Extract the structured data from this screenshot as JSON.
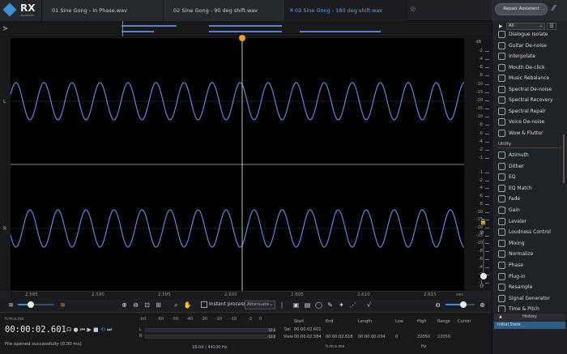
{
  "app": {
    "logo_text": "RX",
    "logo_sub": "ADVANCED"
  },
  "tabs": [
    {
      "label": "01 Sine Gong - In Phase.wav",
      "active": false
    },
    {
      "label": "02 Sine Gong - 90 deg shift.wav",
      "active": false
    },
    {
      "label": "03 Sine Gong - 180 deg shift.wav",
      "active": true
    }
  ],
  "repair_assistant": "Repair Assistant",
  "channels": {
    "left": "L",
    "right": "R"
  },
  "scale_labels": {
    "db": "dB",
    "top": [
      "-2",
      "-4",
      "-6",
      "-8",
      "-10",
      "-15",
      "-20",
      "-15",
      "-10",
      "-8",
      "-6",
      "-4",
      "-2",
      "-1"
    ],
    "bottom": [
      "-1",
      "-2",
      "-4",
      "-6",
      "-8",
      "-10",
      "-15",
      "-20",
      "-15",
      "-10",
      "-8",
      "-6",
      "-4",
      "-2",
      "-1"
    ]
  },
  "timeline": {
    "labels": [
      "2.585",
      "2.590",
      "2.595",
      "2.600",
      "2.605",
      "2.610",
      "2.615"
    ],
    "unit": "sec"
  },
  "toolbar": {
    "instant_process": "Instant process",
    "attenuate": "Attenuate"
  },
  "transport": {
    "format": "h:m:s.ms",
    "time": "00:00:02.601",
    "status": "File opened successfully (0.00 ms)"
  },
  "meter": {
    "scale": [
      "-Inf.",
      "-60",
      "-50",
      "-40",
      "-30",
      "-20",
      "-10",
      "-3",
      "0"
    ],
    "l_label": "L",
    "r_label": "R",
    "l_peak": "-10.0",
    "r_peak": "-10.0",
    "info": "16-bit | 44100 Hz"
  },
  "selection": {
    "headers": [
      "Start",
      "End",
      "Length",
      "Low",
      "High",
      "Range",
      "Cursor"
    ],
    "sel_label": "Sel",
    "view_label": "View",
    "sel_start": "00:00:02.601",
    "view_start": "00:00:02.584",
    "view_end": "00:00:02.618",
    "view_length": "00:00:00.034",
    "low": "0",
    "high": "22050",
    "range": "22050",
    "unit_hms": "h:m:s.ms",
    "unit_hz": "Hz"
  },
  "modules_filter": "All",
  "modules": [
    {
      "label": "Dialogue Isolate",
      "icon": "dialogue-icon"
    },
    {
      "label": "Guitar De-noise",
      "icon": "guitar-icon"
    },
    {
      "label": "Interpolate",
      "icon": "interpolate-icon"
    },
    {
      "label": "Mouth De-click",
      "icon": "mouth-icon"
    },
    {
      "label": "Music Rebalance",
      "icon": "music-icon"
    },
    {
      "label": "Spectral De-noise",
      "icon": "spectral-denoise-icon"
    },
    {
      "label": "Spectral Recovery",
      "icon": "spectral-recovery-icon"
    },
    {
      "label": "Spectral Repair",
      "icon": "spectral-repair-icon"
    },
    {
      "label": "Voice De-noise",
      "icon": "voice-icon"
    },
    {
      "label": "Wow & Flutter",
      "icon": "wow-icon"
    }
  ],
  "utility_label": "Utility",
  "utility": [
    {
      "label": "Azimuth",
      "icon": "azimuth-icon"
    },
    {
      "label": "Dither",
      "icon": "dither-icon"
    },
    {
      "label": "EQ",
      "icon": "eq-icon"
    },
    {
      "label": "EQ Match",
      "icon": "eq-match-icon"
    },
    {
      "label": "Fade",
      "icon": "fade-icon"
    },
    {
      "label": "Gain",
      "icon": "gain-icon"
    },
    {
      "label": "Leveler",
      "icon": "leveler-icon"
    },
    {
      "label": "Loudness Control",
      "icon": "loudness-icon"
    },
    {
      "label": "Mixing",
      "icon": "mixing-icon"
    },
    {
      "label": "Normalize",
      "icon": "normalize-icon"
    },
    {
      "label": "Phase",
      "icon": "phase-icon"
    },
    {
      "label": "Plug-in",
      "icon": "plugin-icon"
    },
    {
      "label": "Resample",
      "icon": "resample-icon"
    },
    {
      "label": "Signal Generator",
      "icon": "signal-icon"
    },
    {
      "label": "Time & Pitch",
      "icon": "time-pitch-icon"
    }
  ],
  "history": {
    "title": "History",
    "items": [
      "Initial State"
    ]
  },
  "colors": {
    "accent": "#3a8fd6",
    "waveform": "#6f8fe6",
    "playhead": "#f0a020"
  }
}
